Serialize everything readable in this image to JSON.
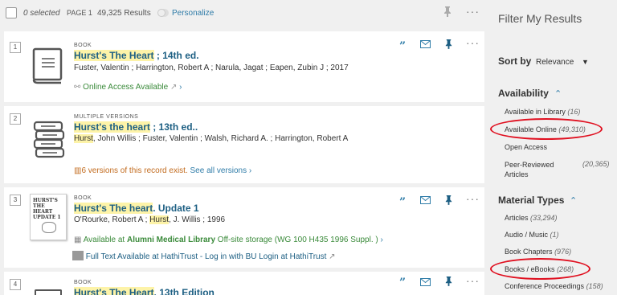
{
  "toolbar": {
    "selected": "0 selected",
    "page": "PAGE 1",
    "results": "49,325 Results",
    "personalize": "Personalize"
  },
  "records": [
    {
      "number": "1",
      "type": "BOOK",
      "title_hl": "Hurst's The Heart",
      "title_rest": " ; 14th ed.",
      "authors": "Fuster, Valentin ; Harrington, Robert A ; Narula, Jagat ; Eapen, Zubin J ; 2017",
      "online": "Online Access Available"
    },
    {
      "number": "2",
      "type": "MULTIPLE VERSIONS",
      "title_hl": "Hurst's the heart",
      "title_rest": " ; 13th ed..",
      "author_hl": "Hurst",
      "authors_rest": ", John Willis ; Fuster, Valentin ; Walsh, Richard A. ; Harrington, Robert A",
      "versions": "6 versions of this record exist.",
      "see_all": "See all versions"
    },
    {
      "number": "3",
      "type": "BOOK",
      "title_hl": "Hurst's The heart",
      "title_rest": ". Update 1",
      "authors_pre": "O'Rourke, Robert A ; ",
      "author_hl": "Hurst",
      "authors_rest": ", J. Willis ; 1996",
      "avail_pre": "Available at ",
      "avail_loc": "Alumni Medical Library",
      "avail_post": " Off-site storage (WG 100 H435 1996 Suppl. )",
      "fulltext": "Full Text Available at HathiTrust - Log in with BU Login at HathiTrust",
      "thumb_text": "HURST'S THE HEART UPDATE 1"
    },
    {
      "number": "4",
      "type": "BOOK",
      "title_hl": "Hurst's The Heart",
      "title_rest": ", 13th Edition"
    }
  ],
  "sidebar": {
    "title": "Filter My Results",
    "sort_label": "Sort by",
    "sort_value": "Relevance",
    "availability": {
      "title": "Availability",
      "items": [
        {
          "label": "Available in Library",
          "count": "(16)"
        },
        {
          "label": "Available Online",
          "count": "(49,310)"
        },
        {
          "label": "Open Access",
          "count": ""
        },
        {
          "label": "Peer-Reviewed",
          "label2": "Articles",
          "count": "(20,365)"
        }
      ]
    },
    "material": {
      "title": "Material Types",
      "items": [
        {
          "label": "Articles",
          "count": "(33,294)"
        },
        {
          "label": "Audio / Music",
          "count": "(1)"
        },
        {
          "label": "Book Chapters",
          "count": "(976)"
        },
        {
          "label": "Books / eBooks",
          "count": "(268)"
        },
        {
          "label": "Conference Proceedings",
          "count": "(158)"
        }
      ]
    }
  },
  "colors": {
    "accent": "#2f7ca8",
    "title": "#1d5f83",
    "highlight": "#fdf3a8",
    "available": "#3a8a3a",
    "versions": "#c26b1e",
    "annotation": "#e01020"
  },
  "icons": {
    "quote": "quote-icon",
    "email": "email-icon",
    "pin": "pin-icon",
    "more": "more-icon",
    "book": "book-icon",
    "stack": "multiple-versions-icon"
  }
}
